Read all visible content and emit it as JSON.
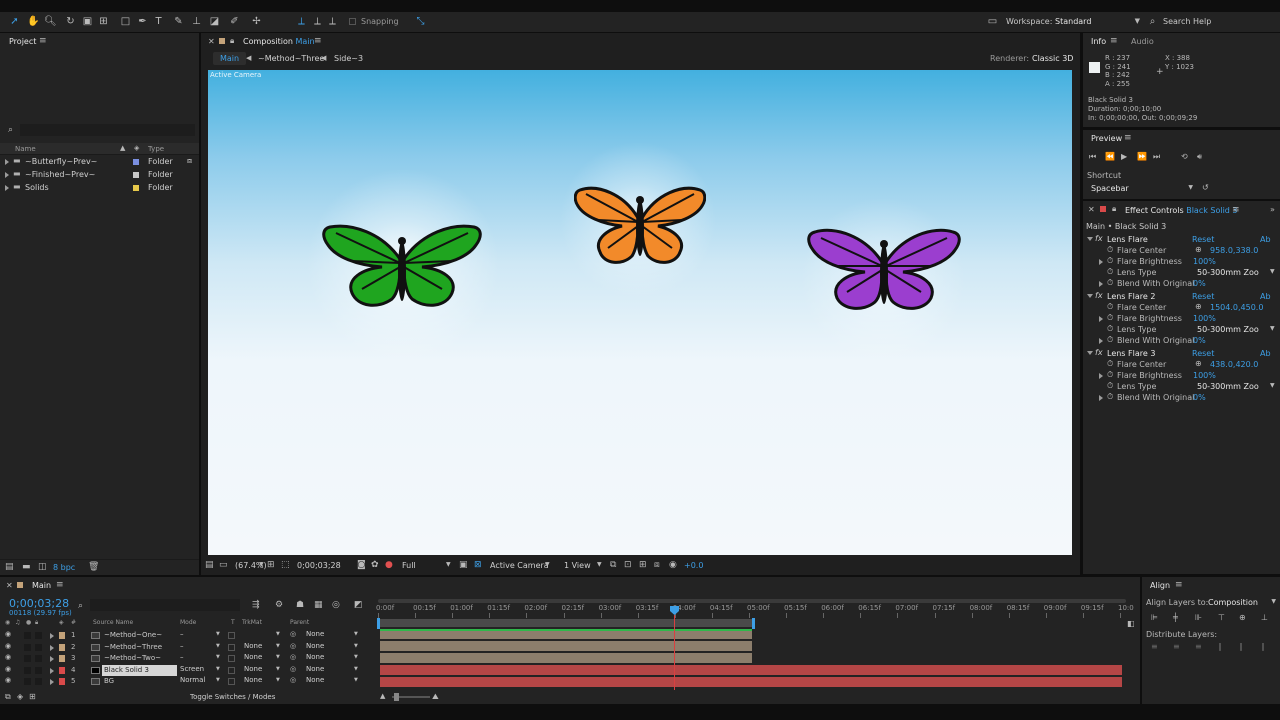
{
  "toolbar": {
    "snapping_label": "Snapping",
    "workspace_label": "Workspace:",
    "workspace_value": "Standard",
    "search_help": "Search Help"
  },
  "project": {
    "title": "Project",
    "search_placeholder": "",
    "col_name": "Name",
    "col_type": "Type",
    "items": [
      {
        "name": "~Butterfly~Prev~",
        "type": "Folder",
        "color": "#7a8fe0"
      },
      {
        "name": "~Finished~Prev~",
        "type": "Folder",
        "color": "#c8c8c8"
      },
      {
        "name": "Solids",
        "type": "Folder",
        "color": "#e6c84a"
      }
    ],
    "bpc": "8 bpc"
  },
  "composition": {
    "title_prefix": "Composition",
    "title_name": "Main",
    "nav": [
      "Main",
      "~Method~Three",
      "Side~3"
    ],
    "renderer_label": "Renderer:",
    "renderer_value": "Classic 3D",
    "active_camera_overlay": "Active Camera",
    "zoom": "(67.4%)",
    "timecode": "0;00;03;28",
    "resolution": "Full",
    "camera": "Active Camera",
    "views": "1 View",
    "exposure": "+0.0"
  },
  "info": {
    "tabs": [
      "Info",
      "Audio"
    ],
    "r": "R : 237",
    "g": "G : 241",
    "b": "B : 242",
    "a": "A : 255",
    "x": "X : 388",
    "y": "Y : 1023",
    "layer_name": "Black Solid 3",
    "duration": "Duration: 0;00;10;00",
    "inout": "In: 0;00;00;00, Out: 0;00;09;29"
  },
  "preview": {
    "title": "Preview",
    "shortcut_label": "Shortcut",
    "shortcut_value": "Spacebar"
  },
  "effects": {
    "title": "Effect Controls",
    "layer": "Black Solid 3",
    "breadcrumb": "Main • Black Solid 3",
    "groups": [
      {
        "name": "Lens Flare",
        "reset": "Reset",
        "about": "Ab",
        "center": "958.0,338.0",
        "brightness": "100%",
        "lens": "50-300mm Zoo",
        "blend": "0%"
      },
      {
        "name": "Lens Flare 2",
        "reset": "Reset",
        "about": "Ab",
        "center": "1504.0,450.0",
        "brightness": "100%",
        "lens": "50-300mm Zoo",
        "blend": "0%"
      },
      {
        "name": "Lens Flare 3",
        "reset": "Reset",
        "about": "Ab",
        "center": "438.0,420.0",
        "brightness": "100%",
        "lens": "50-300mm Zoo",
        "blend": "0%"
      }
    ],
    "prop_labels": {
      "center": "Flare Center",
      "brightness": "Flare Brightness",
      "lens": "Lens Type",
      "blend": "Blend With Original"
    }
  },
  "timeline": {
    "tab": "Main",
    "timecode": "0;00;03;28",
    "frames": "00118 (29.97 fps)",
    "cols": {
      "num": "#",
      "source": "Source Name",
      "mode": "Mode",
      "t": "T",
      "trkmat": "TrkMat",
      "parent": "Parent"
    },
    "layers": [
      {
        "num": "1",
        "name": "~Method~One~",
        "mode": "–",
        "trkmat": "",
        "parent": "None",
        "color": "#c4a37a"
      },
      {
        "num": "2",
        "name": "~Method~Three",
        "mode": "–",
        "trkmat": "None",
        "parent": "None",
        "color": "#c4a37a"
      },
      {
        "num": "3",
        "name": "~Method~Two~",
        "mode": "–",
        "trkmat": "None",
        "parent": "None",
        "color": "#c4a37a"
      },
      {
        "num": "4",
        "name": "Black Solid 3",
        "mode": "Screen",
        "trkmat": "None",
        "parent": "None",
        "color": "#d94a4a"
      },
      {
        "num": "5",
        "name": "BG",
        "mode": "Normal",
        "trkmat": "None",
        "parent": "None",
        "color": "#d94a4a"
      }
    ],
    "ruler": [
      "0:00f",
      "00:15f",
      "01:00f",
      "01:15f",
      "02:00f",
      "02:15f",
      "03:00f",
      "03:15f",
      "04:00f",
      "04:15f",
      "05:00f",
      "05:15f",
      "06:00f",
      "06:15f",
      "07:00f",
      "07:15f",
      "08:00f",
      "08:15f",
      "09:00f",
      "09:15f",
      "10:0"
    ],
    "toggle": "Toggle Switches / Modes"
  },
  "align": {
    "title": "Align",
    "align_to_label": "Align Layers to:",
    "align_to_value": "Composition",
    "distribute_label": "Distribute Layers:"
  }
}
